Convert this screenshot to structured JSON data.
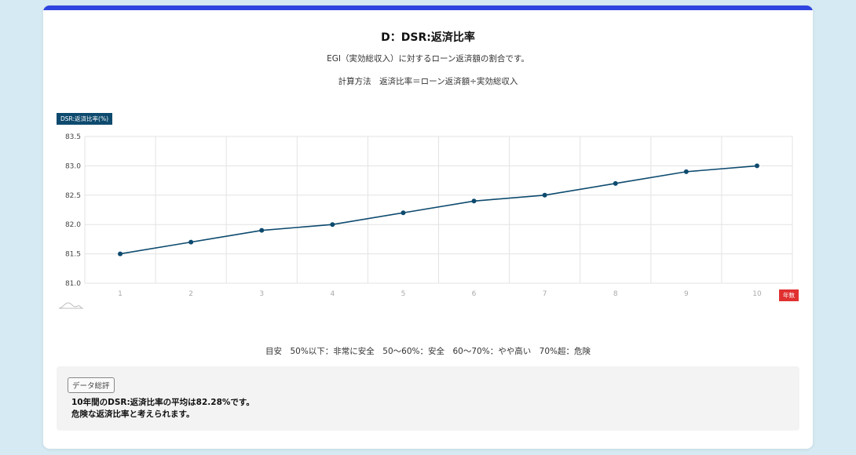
{
  "title": "D：DSR:返済比率",
  "description": "EGI（実効総収入）に対するローン返済額の割合です。",
  "formula": "計算方法　返済比率＝ローン返済額÷実効総収入",
  "guide": "目安　50%以下：非常に安全　50〜60%：安全　60〜70%：やや高い　70%超：危険",
  "summary": {
    "tag": "データ総評",
    "line1": "10年間のDSR:返済比率の平均は82.28%です。",
    "line2": "危険な返済比率と考えられます。"
  },
  "colors": {
    "accent_bar": "#2f45e0",
    "line": "#0d4a6e",
    "y_badge": "#0d4a6e",
    "x_badge": "#e03030",
    "grid": "#e3e3e3"
  },
  "chart_data": {
    "type": "line",
    "ylabel": "DSR:返済比率(%)",
    "xlabel": "年数",
    "x": [
      1,
      2,
      3,
      4,
      5,
      6,
      7,
      8,
      9,
      10
    ],
    "y_ticks": [
      "83.5",
      "83.0",
      "82.5",
      "82.0",
      "81.5",
      "81.0"
    ],
    "ylim": [
      81.0,
      83.5
    ],
    "grid": true,
    "series": [
      {
        "values": [
          81.5,
          81.7,
          81.9,
          82.0,
          82.2,
          82.4,
          82.5,
          82.7,
          82.9,
          83.0
        ]
      }
    ]
  }
}
